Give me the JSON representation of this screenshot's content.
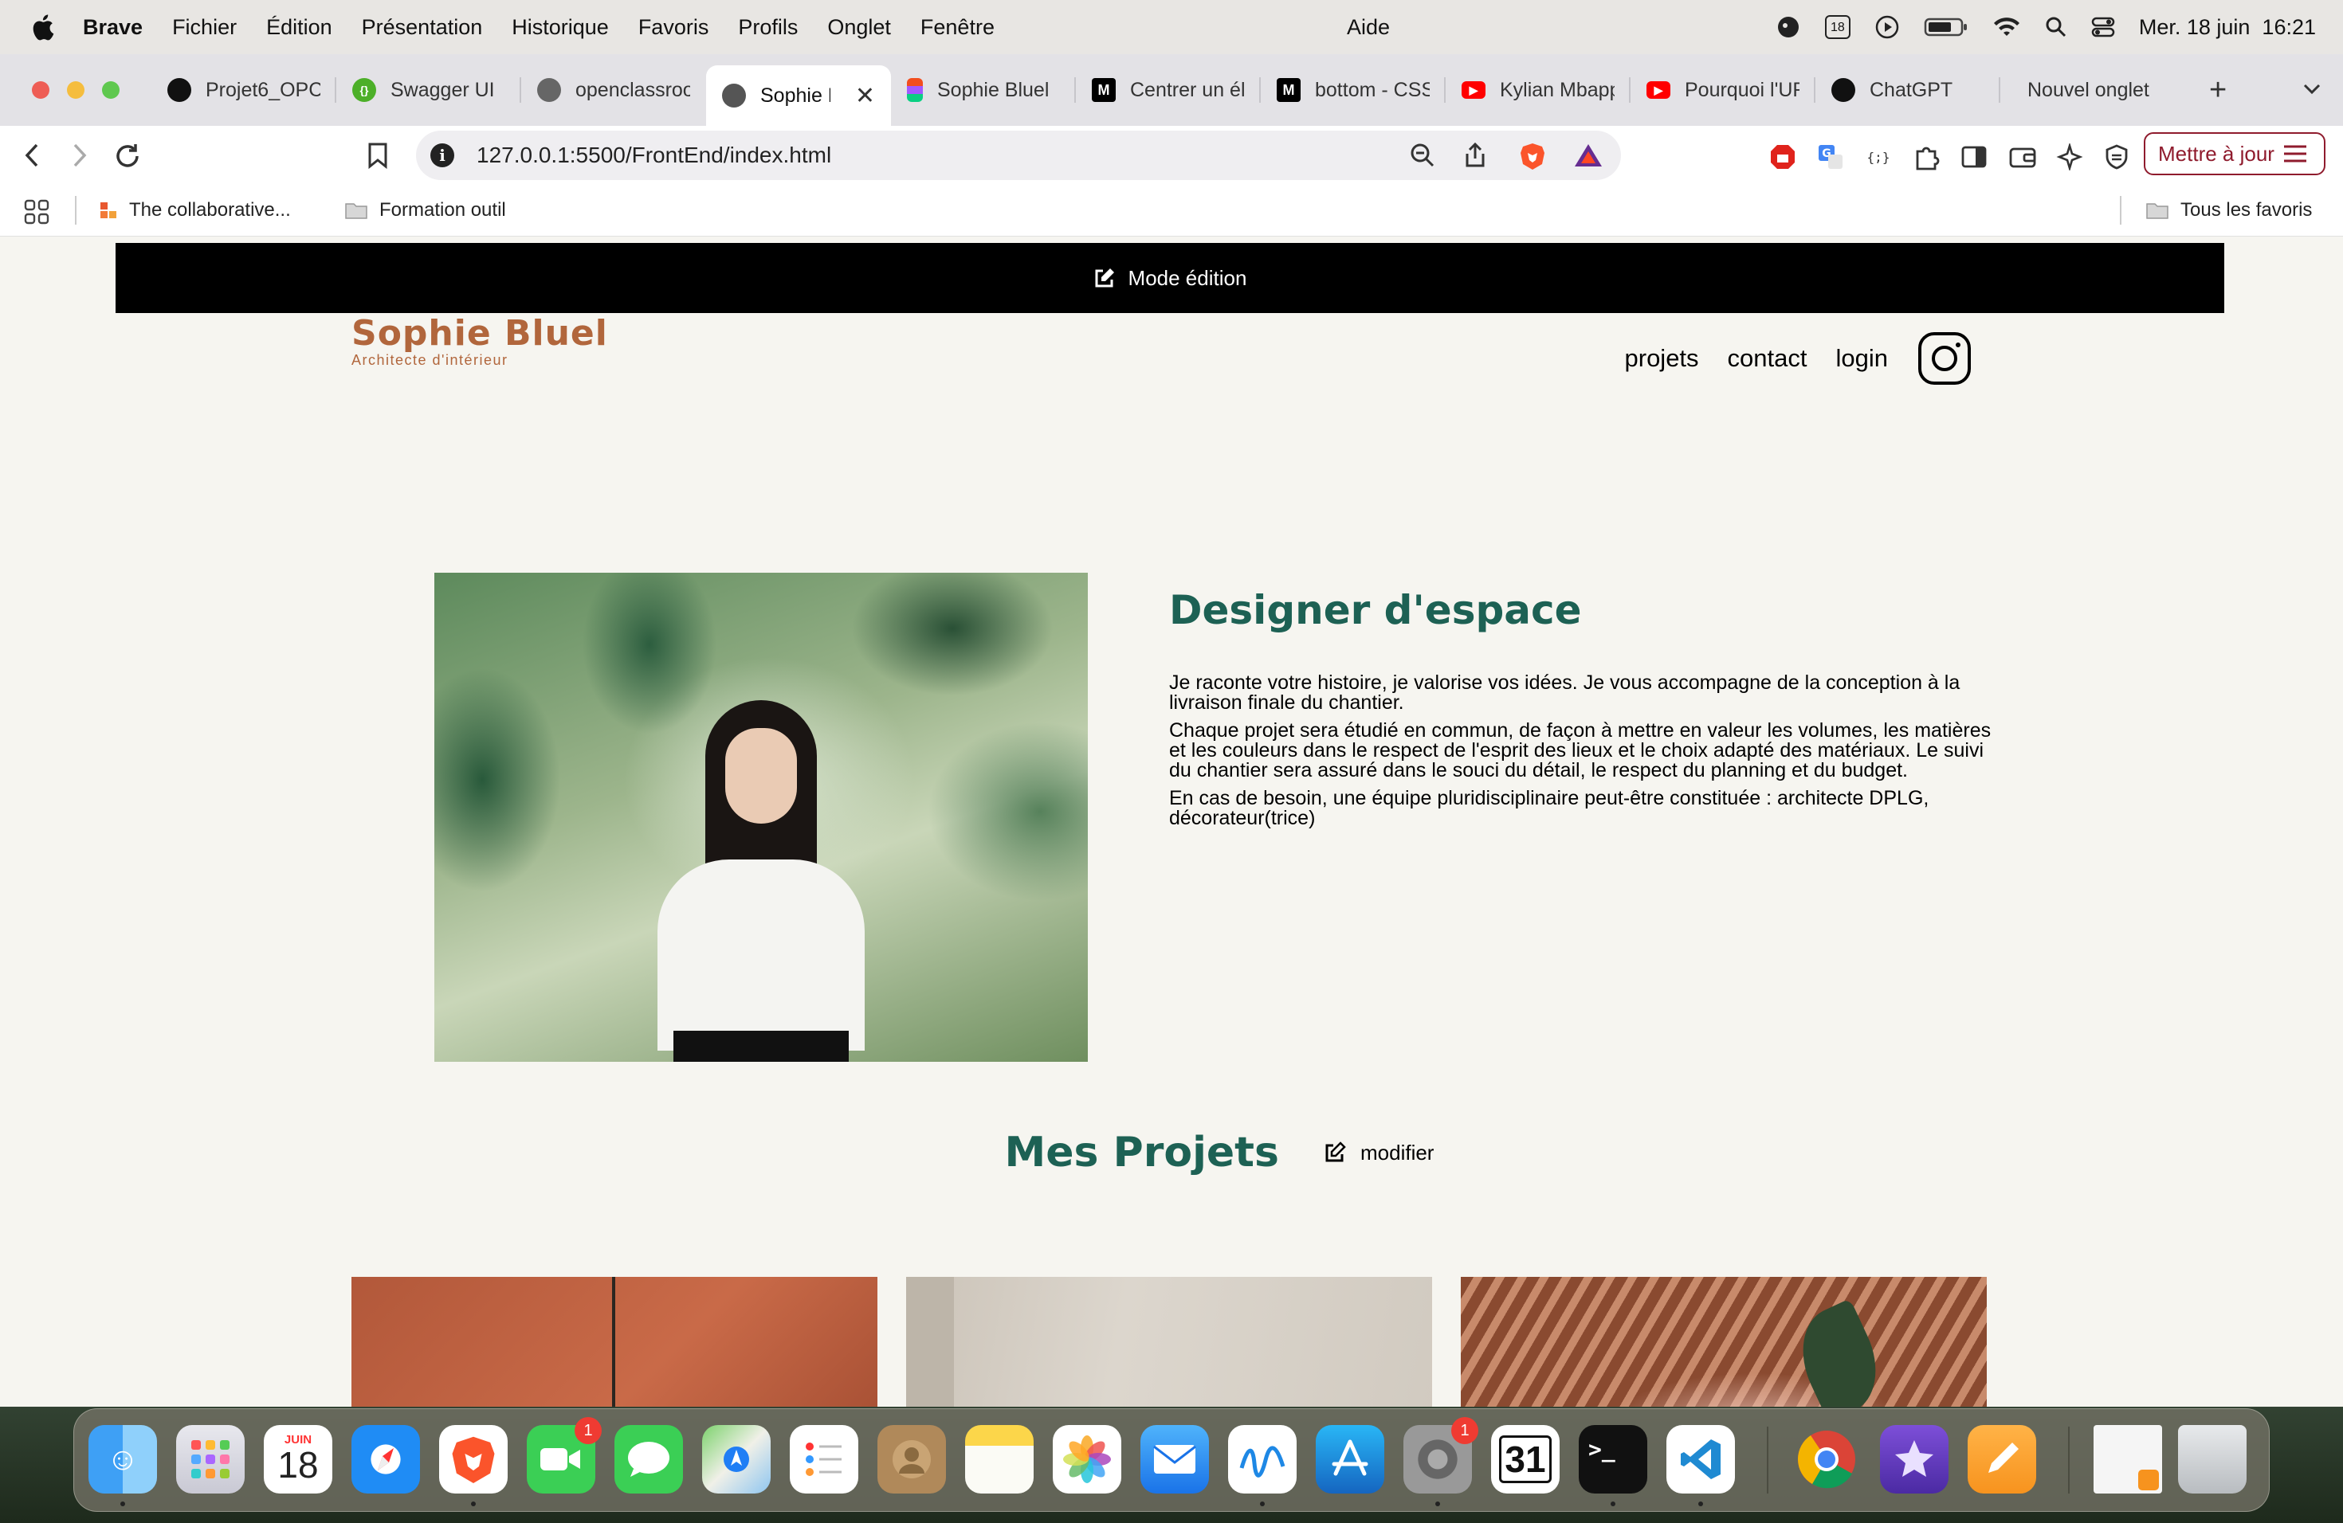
{
  "menubar": {
    "app": "Brave",
    "items": [
      "Fichier",
      "Édition",
      "Présentation",
      "Historique",
      "Favoris",
      "Profils",
      "Onglet",
      "Fenêtre"
    ],
    "center": "Aide",
    "calendar_day": "18",
    "datetime": "Mer. 18 juin  16:21"
  },
  "tabs": [
    {
      "title": "Projet6_OPC",
      "icon": "github-icon",
      "color": "#111111"
    },
    {
      "title": "Swagger UI",
      "icon": "swagger-icon",
      "color": "#4caf28"
    },
    {
      "title": "openclassrooms",
      "icon": "globe-icon",
      "color": "#666666"
    },
    {
      "title": "Sophie Bluel",
      "icon": "globe-icon",
      "color": "#555555",
      "active": true
    },
    {
      "title": "Sophie Bluel",
      "icon": "figma-icon",
      "color": "#f24e1e"
    },
    {
      "title": "Centrer un élément",
      "icon": "mdn-icon",
      "color": "#000000"
    },
    {
      "title": "bottom - CSS",
      "icon": "mdn-icon",
      "color": "#000000"
    },
    {
      "title": "Kylian Mbappé",
      "icon": "youtube-icon",
      "color": "#ff0000"
    },
    {
      "title": "Pourquoi l'URSS",
      "icon": "youtube-icon",
      "color": "#ff0000"
    },
    {
      "title": "ChatGPT",
      "icon": "chatgpt-icon",
      "color": "#111111"
    },
    {
      "title": "Nouvel onglet",
      "icon": "",
      "color": ""
    }
  ],
  "address": {
    "url": "127.0.0.1:5500/FrontEnd/index.html",
    "update_button": "Mettre à jour"
  },
  "bookmarks": {
    "item1": "The collaborative...",
    "item2": "Formation outil",
    "all": "Tous les favoris"
  },
  "site": {
    "edit_banner": "Mode édition",
    "logo_name": "Sophie Bluel",
    "logo_sub": "Architecte d'intérieur",
    "nav": {
      "projects": "projets",
      "contact": "contact",
      "login": "login"
    },
    "about_title": "Designer d'espace",
    "about_p1": "Je raconte votre histoire, je valorise vos idées. Je vous accompagne de la conception à la livraison finale du chantier.",
    "about_p2": "Chaque projet sera étudié en commun, de façon à mettre en valeur les volumes, les matières et les couleurs dans le respect de l'esprit des lieux et le choix adapté des matériaux. Le suivi du chantier sera assuré dans le souci du détail, le respect du planning et du budget.",
    "about_p3": "En cas de besoin, une équipe pluridisciplinaire peut-être constituée : architecte DPLG, décorateur(trice)",
    "projects_title": "Mes Projets",
    "modify": "modifier"
  },
  "dock": {
    "calendar_month": "JUIN",
    "calendar_day": "18",
    "facetime_badge": "1",
    "settings_badge": "1",
    "fantastical_day": "31"
  },
  "colors": {
    "accent_green": "#1d6154",
    "logo_brown": "#b1663c",
    "update_red": "#8f1b2d"
  }
}
